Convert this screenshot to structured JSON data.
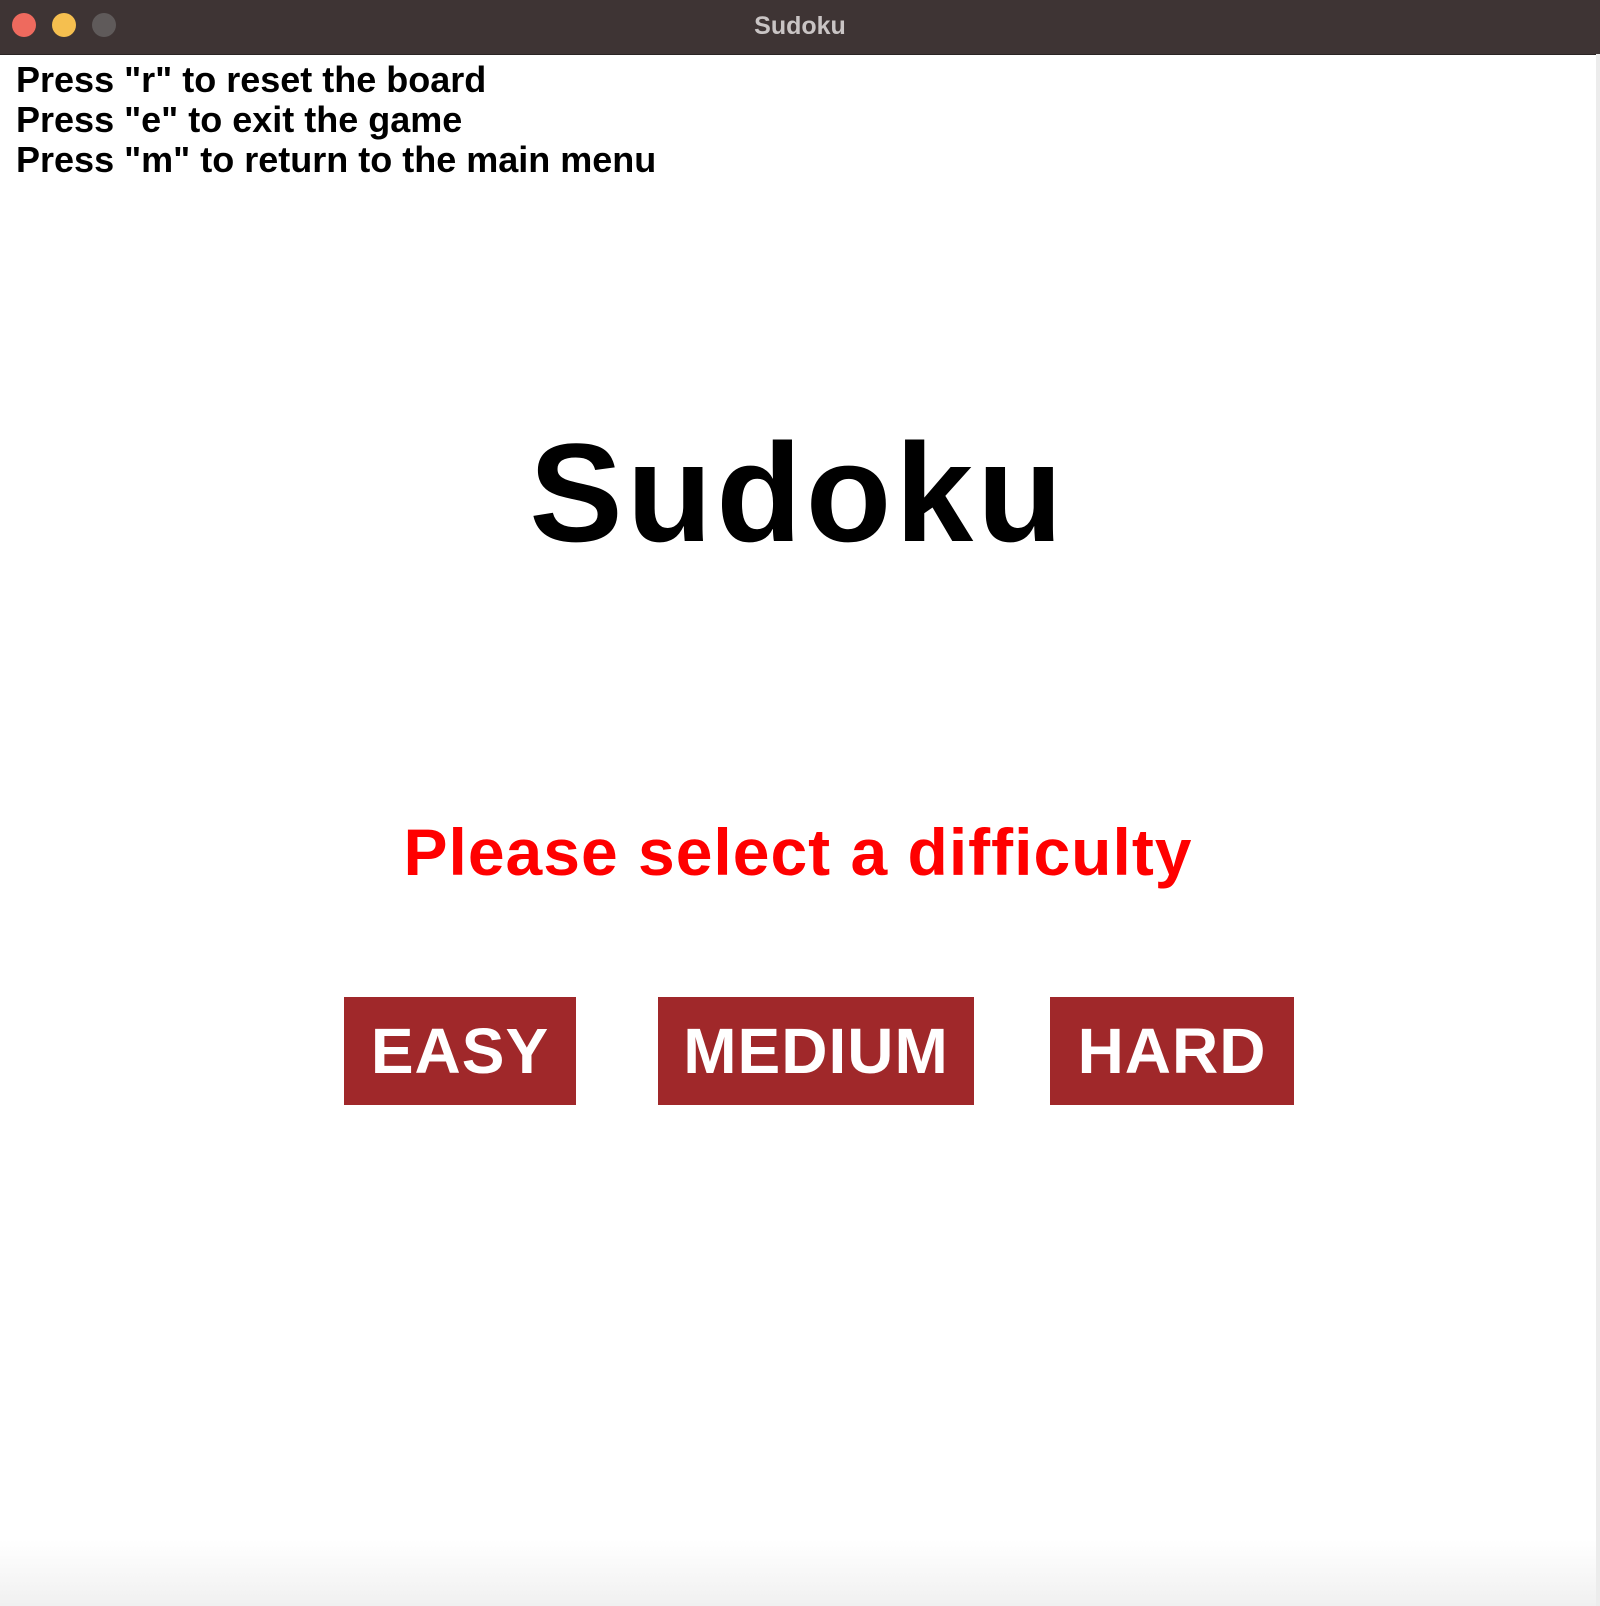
{
  "window": {
    "title": "Sudoku",
    "controls": {
      "close_color": "#ee6a5e",
      "minimize_color": "#f5bf4f",
      "zoom_color": "#5f5a5a"
    }
  },
  "instructions": [
    "Press \"r\" to reset the board",
    "Press \"e\" to exit the game",
    "Press \"m\" to return to the main menu"
  ],
  "game_title": "Sudoku",
  "prompt": {
    "text": "Please select a difficulty",
    "color": "#ff0000"
  },
  "difficulty_buttons": [
    {
      "label": "EASY"
    },
    {
      "label": "MEDIUM"
    },
    {
      "label": "HARD"
    }
  ],
  "colors": {
    "button_bg": "#a0282a",
    "button_text": "#ffffff",
    "titlebar": "#3e3434"
  }
}
